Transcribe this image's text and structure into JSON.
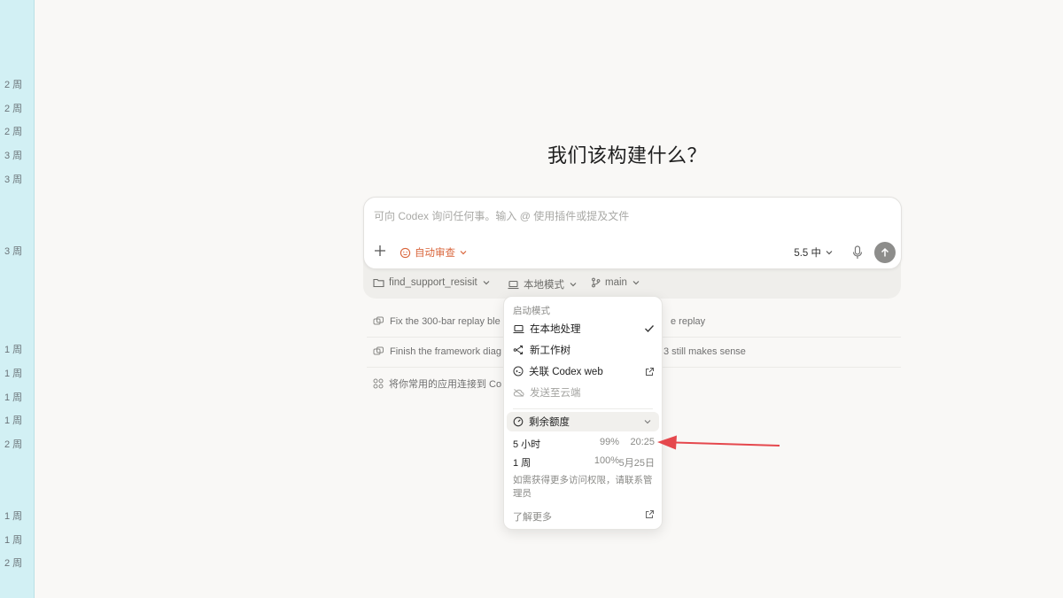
{
  "sidebar": {
    "labels": [
      "2 周",
      "2 周",
      "2 周",
      "3 周",
      "3 周",
      "3 周",
      "1 周",
      "1 周",
      "1 周",
      "1 周",
      "2 周",
      "1 周",
      "1 周",
      "2 周"
    ]
  },
  "main": {
    "heading": "我们该构建什么？"
  },
  "composer": {
    "placeholder": "可向 Codex 询问任何事。输入 @ 使用插件或提及文件",
    "review_label": "自动审查",
    "model_label": "5.5 中"
  },
  "toolbar": {
    "folder": "find_support_resisit",
    "mode": "本地模式",
    "branch": "main"
  },
  "suggestions": [
    {
      "left": "Fix the 300-bar replay ble",
      "right": "e replay"
    },
    {
      "left": "Finish the framework diag",
      "right": "3 still makes sense"
    },
    {
      "left": "将你常用的应用连接到 Co",
      "right": ""
    }
  ],
  "dropdown": {
    "section_title": "启动模式",
    "items": {
      "local": "在本地处理",
      "worktree": "新工作树",
      "codex_web": "关联 Codex web",
      "cloud": "发送至云端"
    },
    "quota_title": "剩余额度",
    "quota": [
      {
        "label": "5 小时",
        "pct": "99%",
        "reset": "20:25"
      },
      {
        "label": "1 周",
        "pct": "100%",
        "reset": "5月25日"
      }
    ],
    "note": "如需获得更多访问权限，请联系管理员",
    "learn_more": "了解更多"
  },
  "colors": {
    "accent_orange": "#d9653b",
    "arrow_red": "#e5484d",
    "sidebar_bg": "#d2f0f4"
  }
}
